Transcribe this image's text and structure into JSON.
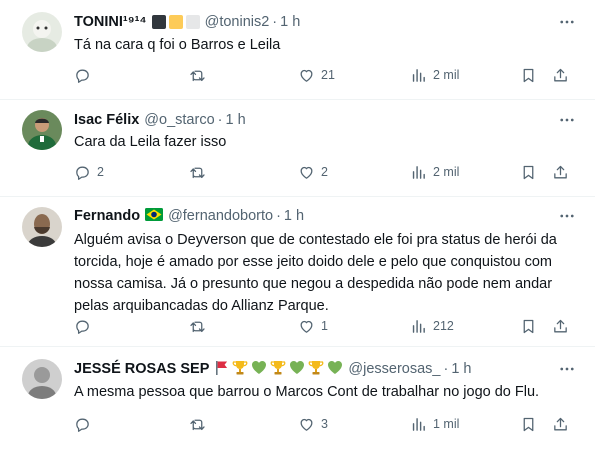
{
  "tweets": [
    {
      "name": "TONINI¹⁹¹⁴",
      "handle": "@toninis2",
      "time": "1 h",
      "text": "Tá na cara q foi o Barros e Leila",
      "replies": "",
      "retweets": "",
      "likes": "21",
      "views": "2 mil",
      "badges": [
        "black-square",
        "yellow-square",
        "white-square"
      ]
    },
    {
      "name": "Isac Félix",
      "handle": "@o_starco",
      "time": "1 h",
      "text": "Cara da Leila fazer isso",
      "replies": "2",
      "retweets": "",
      "likes": "2",
      "views": "2 mil"
    },
    {
      "name": "Fernando",
      "handle": "@fernandoborto",
      "time": "1 h",
      "text": "Alguém avisa o Deyverson que de contestado ele foi pra status de herói da torcida, hoje é amado por esse jeito doido dele e pelo que conquistou com nossa camisa. Já o presunto que negou a despedida não pode nem andar pelas arquibancadas do Allianz Parque.",
      "replies": "",
      "retweets": "",
      "likes": "1",
      "views": "212",
      "badges": [
        "brazil-flag"
      ]
    },
    {
      "name": "JESSÉ ROSAS SEP",
      "handle": "@jesserosas_",
      "time": "1 h",
      "text": "A mesma pessoa que barrou o Marcos Cont de trabalhar no jogo do Flu.",
      "replies": "",
      "retweets": "",
      "likes": "3",
      "views": "1 mil",
      "badges": [
        "red-flag",
        "trophy",
        "green-heart",
        "trophy",
        "green-heart",
        "trophy",
        "green-heart"
      ]
    }
  ],
  "colors": {
    "text": "#0f1419",
    "muted": "#536471",
    "divider": "#eff3f4"
  }
}
